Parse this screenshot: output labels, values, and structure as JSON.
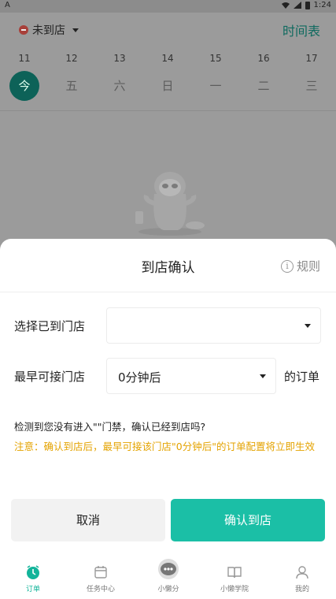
{
  "statusbar": {
    "left_icon": "A",
    "time": "1:24"
  },
  "header": {
    "status_label": "未到店",
    "schedule_link": "时间表"
  },
  "week": [
    {
      "num": "11",
      "name": "今",
      "today": true
    },
    {
      "num": "12",
      "name": "五"
    },
    {
      "num": "13",
      "name": "六"
    },
    {
      "num": "14",
      "name": "日"
    },
    {
      "num": "15",
      "name": "一"
    },
    {
      "num": "16",
      "name": "二"
    },
    {
      "num": "17",
      "name": "三"
    }
  ],
  "modal": {
    "title": "到店确认",
    "rules_label": "规则",
    "store_label": "选择已到门店",
    "store_value": "",
    "earliest_label": "最早可接门店",
    "earliest_value": "0分钟后",
    "earliest_suffix": "的订单",
    "detect_text": "检测到您没有进入\"\"门禁，确认已经到店吗?",
    "notice_text": "注意：确认到店后，最早可接该门店\"0分钟后\"的订单配置将立即生效",
    "cancel_label": "取消",
    "confirm_label": "确认到店"
  },
  "tabs": [
    {
      "label": "订单",
      "icon": "clock-icon",
      "active": true
    },
    {
      "label": "任务中心",
      "icon": "calendar-icon"
    },
    {
      "label": "小懒分",
      "icon": "chat-bubble-icon"
    },
    {
      "label": "小懒学院",
      "icon": "book-icon"
    },
    {
      "label": "我的",
      "icon": "person-icon"
    }
  ],
  "colors": {
    "accent": "#1bbfa6",
    "warning": "#e4a300",
    "today": "#0d6258"
  }
}
